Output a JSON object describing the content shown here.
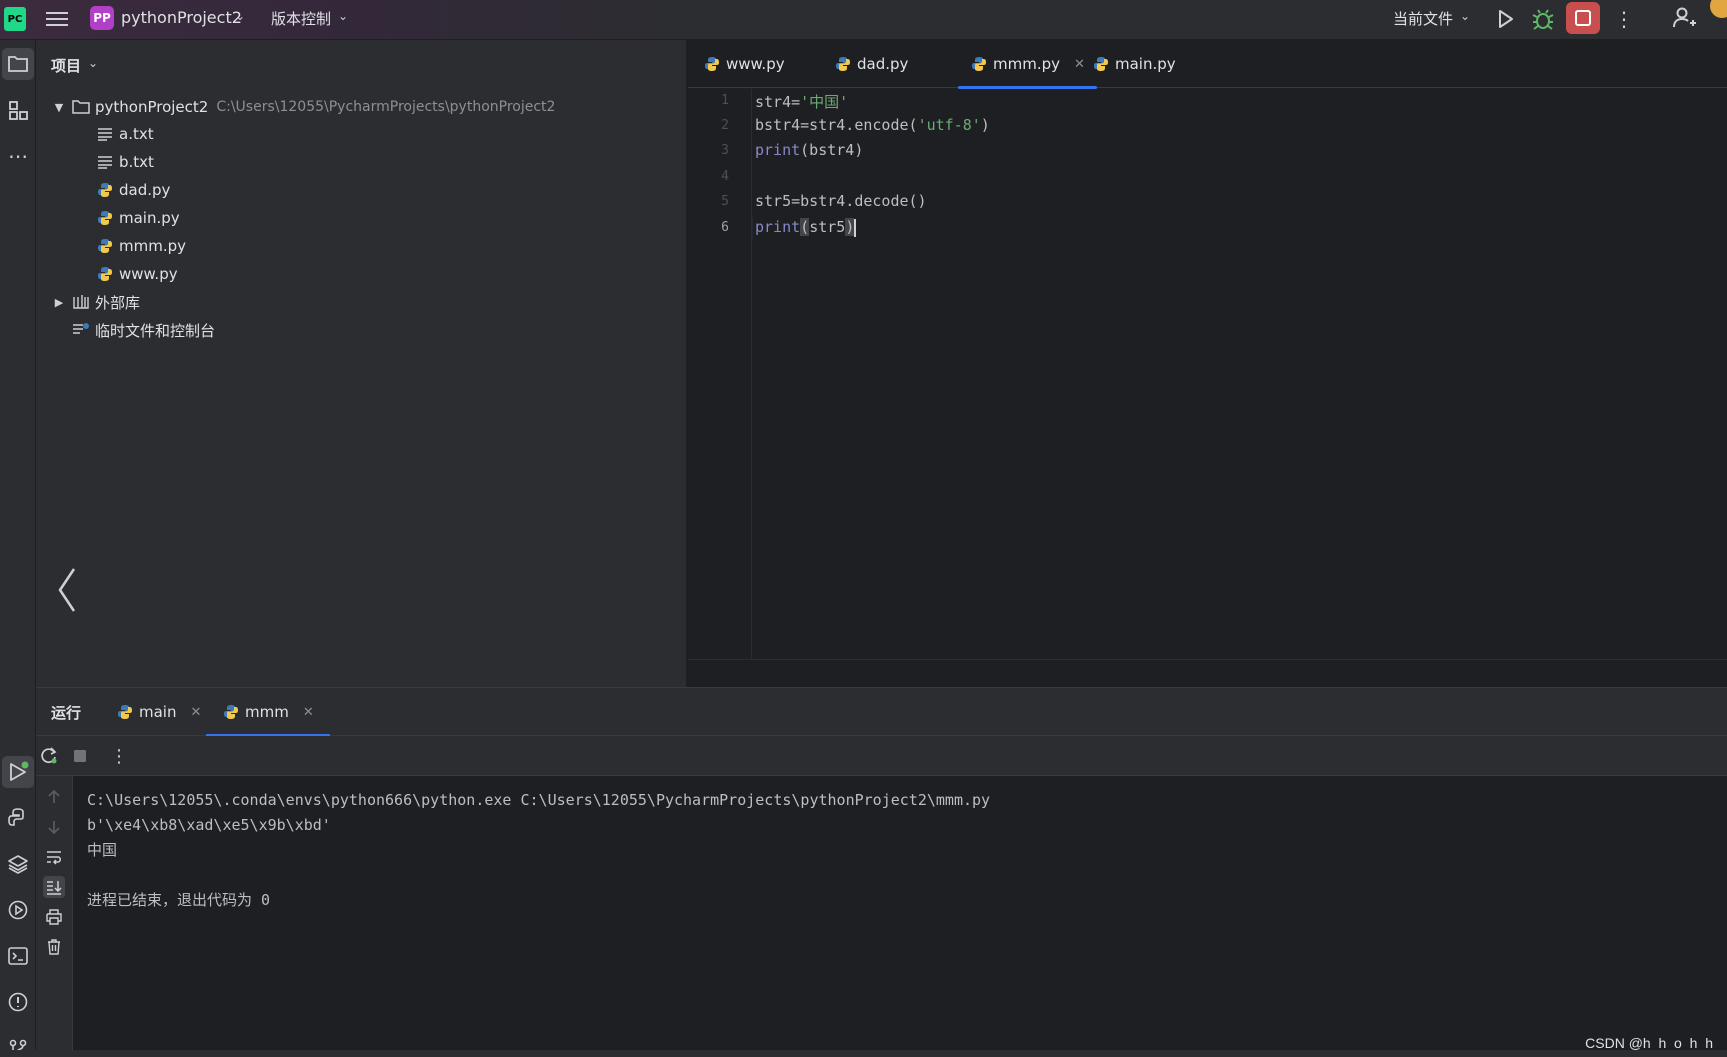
{
  "titlebar": {
    "logo_text": "PC",
    "project_badge": "PP",
    "project_name": "pythonProject2",
    "vcs_label": "版本控制",
    "run_config": "当前文件"
  },
  "project_panel": {
    "header": "项目",
    "root": {
      "name": "pythonProject2",
      "path": "C:\\Users\\12055\\PycharmProjects\\pythonProject2"
    },
    "files": [
      {
        "name": "a.txt",
        "icon": "text-file-icon"
      },
      {
        "name": "b.txt",
        "icon": "text-file-icon"
      },
      {
        "name": "dad.py",
        "icon": "python-file-icon"
      },
      {
        "name": "main.py",
        "icon": "python-file-icon"
      },
      {
        "name": "mmm.py",
        "icon": "python-file-icon"
      },
      {
        "name": "www.py",
        "icon": "python-file-icon"
      }
    ],
    "external_libs": "外部库",
    "scratches": "临时文件和控制台"
  },
  "editor": {
    "tabs": [
      {
        "label": "www.py"
      },
      {
        "label": "dad.py"
      },
      {
        "label": "mmm.py",
        "active": true
      },
      {
        "label": "main.py"
      }
    ],
    "line_numbers": [
      "1",
      "2",
      "3",
      "4",
      "5",
      "6"
    ],
    "lines": {
      "l1_a": "str4=",
      "l1_b": "'中国'",
      "l2_a": "bstr4=str4.encode(",
      "l2_b": "'utf-8'",
      "l2_c": ")",
      "l3_a": "print",
      "l3_b": "(bstr4)",
      "l5": "str5=bstr4.decode()",
      "l6_a": "print",
      "l6_b": "(",
      "l6_c": "str5",
      "l6_d": ")"
    }
  },
  "run_panel": {
    "title": "运行",
    "tabs": [
      {
        "label": "main"
      },
      {
        "label": "mmm",
        "active": true
      }
    ],
    "console": [
      "C:\\Users\\12055\\.conda\\envs\\python666\\python.exe C:\\Users\\12055\\PycharmProjects\\pythonProject2\\mmm.py",
      "b'\\xe4\\xb8\\xad\\xe5\\x9b\\xbd'",
      "中国",
      "",
      "进程已结束，退出代码为 0"
    ]
  },
  "watermark": "CSDN @h_h_o_h_h",
  "colors": {
    "accent": "#3574f0",
    "stop": "#c94f4f",
    "string": "#6aab73",
    "builtin": "#8888c6"
  }
}
